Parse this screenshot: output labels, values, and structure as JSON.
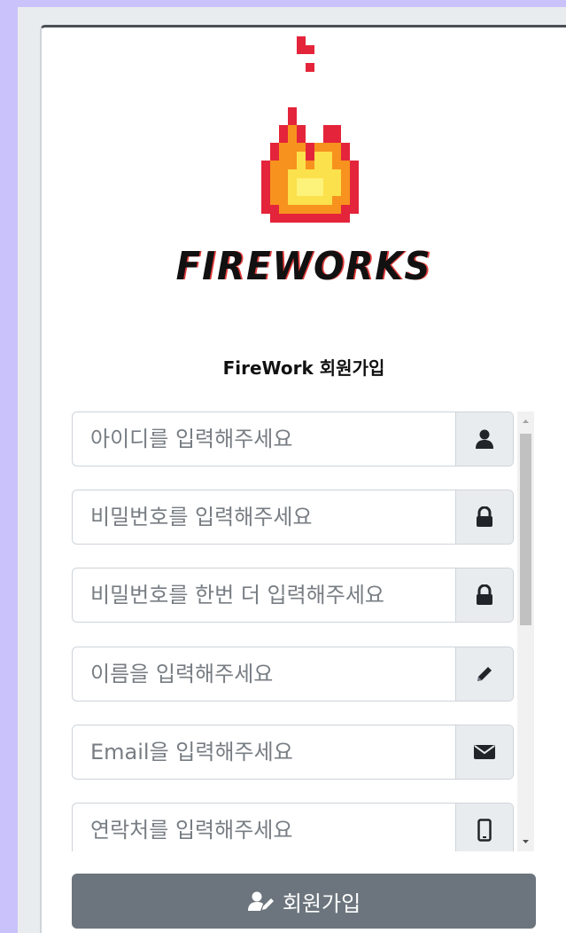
{
  "logo": {
    "text": "FIREWORKS"
  },
  "form": {
    "title": "FireWork 회원가입",
    "fields": [
      {
        "placeholder": "아이디를 입력해주세요",
        "icon": "user-icon"
      },
      {
        "placeholder": "비밀번호를 입력해주세요",
        "icon": "lock-icon"
      },
      {
        "placeholder": "비밀번호를 한번 더 입력해주세요",
        "icon": "lock-icon"
      },
      {
        "placeholder": "이름을 입력해주세요",
        "icon": "pencil-icon"
      },
      {
        "placeholder": "Email을 입력해주세요",
        "icon": "envelope-icon"
      },
      {
        "placeholder": "연락처를 입력해주세요",
        "icon": "mobile-icon"
      }
    ],
    "submit_label": "회원가입",
    "submit_icon": "user-edit-icon"
  },
  "colors": {
    "background": "#c9c2fb",
    "button": "#6c757d",
    "addon": "#e9ecef"
  }
}
